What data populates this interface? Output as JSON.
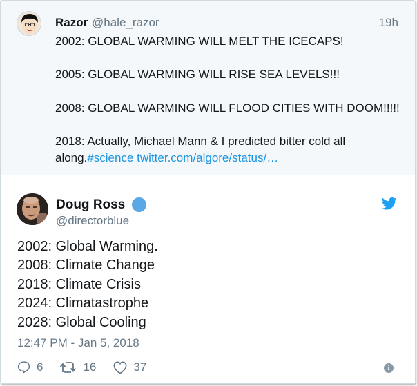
{
  "quoted": {
    "name": "Razor",
    "handle": "@hale_razor",
    "time": "19h",
    "lines": [
      "2002: GLOBAL WARMING WILL MELT THE ICECAPS!",
      "",
      "2005: GLOBAL WARMING WILL RISE SEA LEVELS!!!",
      "",
      "2008: GLOBAL WARMING WILL FLOOD CITIES WITH DOOM!!!!!",
      "",
      "2018: Actually, Michael Mann & I predicted bitter cold all"
    ],
    "last_line_prefix": "along.",
    "hashtag": "#science",
    "link": "twitter.com/algore/status/…"
  },
  "tweet": {
    "name": "Doug Ross",
    "handle": "@directorblue",
    "lines": [
      "2002: Global Warming.",
      "2008: Climate Change",
      "2018: Climate Crisis",
      "2024: Climatastrophe",
      "2028: Global Cooling"
    ],
    "timestamp": "12:47 PM - Jan 5, 2018",
    "replies": "6",
    "retweets": "16",
    "likes": "37",
    "info_glyph": "i"
  },
  "icons": {
    "verified": "verified-badge-icon",
    "twitter": "twitter-bird-icon",
    "reply": "reply-icon",
    "retweet": "retweet-icon",
    "like": "heart-icon",
    "info": "info-icon"
  },
  "colors": {
    "link": "#1b95e0",
    "twitter_blue": "#1da1f2",
    "muted": "#657786",
    "quoted_bg": "#f5f8fa"
  }
}
